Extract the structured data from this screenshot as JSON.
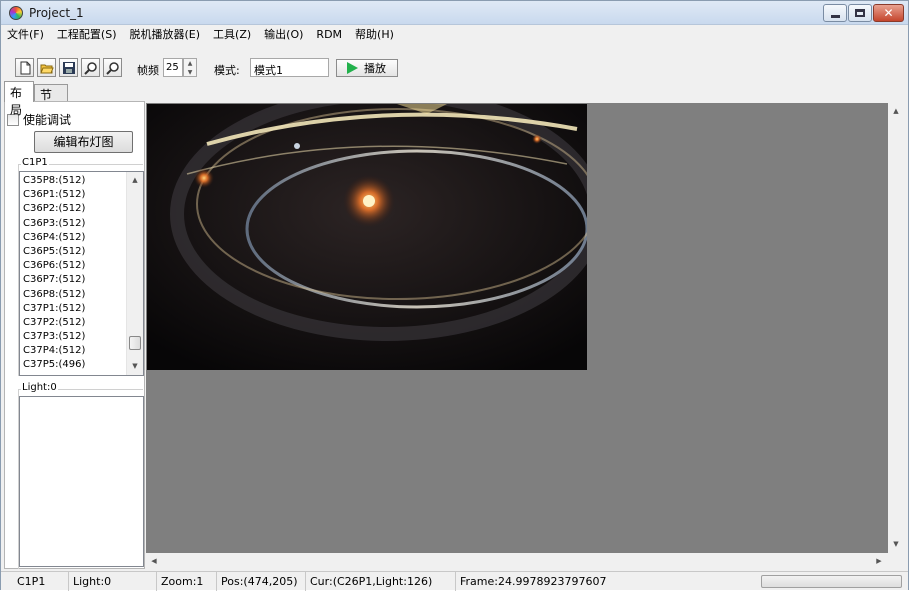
{
  "window": {
    "title": "Project_1"
  },
  "menu": [
    "文件(F)",
    "工程配置(S)",
    "脱机播放器(E)",
    "工具(Z)",
    "输出(O)",
    "RDM",
    "帮助(H)"
  ],
  "toolbar": {
    "frame_rate_label": "帧频",
    "frame_rate_value": "25",
    "mode_label": "模式:",
    "mode_value": "模式1",
    "play_label": "播放"
  },
  "tabs": {
    "layout": "布局",
    "program": "节目"
  },
  "panel": {
    "enable_debug_label": "使能调试",
    "edit_layout_button": "编辑布灯图",
    "group_label": "C1P1",
    "list": [
      "C35P8:(512)",
      "C36P1:(512)",
      "C36P2:(512)",
      "C36P3:(512)",
      "C36P4:(512)",
      "C36P5:(512)",
      "C36P6:(512)",
      "C36P7:(512)",
      "C36P8:(512)",
      "C37P1:(512)",
      "C37P2:(512)",
      "C37P3:(512)",
      "C37P4:(512)",
      "C37P5:(496)"
    ],
    "list_scroll_fraction": 0.95,
    "light_group_label": "Light:0"
  },
  "status": {
    "port": "C1P1",
    "light": "Light:0",
    "zoom": "Zoom:1",
    "pos": "Pos:(474,205)",
    "cur": "Cur:(C26P1,Light:126)",
    "frame": "Frame:24.9978923797607"
  }
}
